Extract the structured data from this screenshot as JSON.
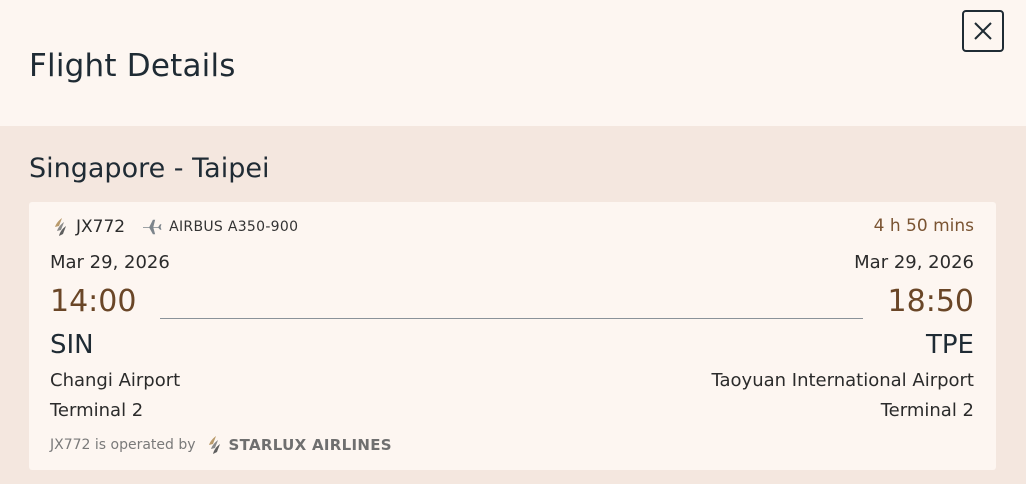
{
  "header": {
    "title": "Flight Details",
    "close_icon": "close-icon"
  },
  "route": {
    "title": "Singapore - Taipei"
  },
  "flight": {
    "brand_icon": "starlux-logo-icon",
    "number": "JX772",
    "aircraft_icon": "plane-icon",
    "aircraft": "AIRBUS A350-900",
    "duration": "4 h 50 mins",
    "departure": {
      "date": "Mar 29, 2026",
      "time": "14:00",
      "code": "SIN",
      "airport": "Changi Airport",
      "terminal": "Terminal 2"
    },
    "arrival": {
      "date": "Mar 29, 2026",
      "time": "18:50",
      "code": "TPE",
      "airport": "Taoyuan International Airport",
      "terminal": "Terminal 2"
    },
    "operated_by_text": "JX772 is operated by",
    "operator_logo_icon": "starlux-logo-icon",
    "operator_name": "STARLUX AIRLINES"
  },
  "colors": {
    "background": "#fdf6f1",
    "section_background": "#f4e7df",
    "time_accent": "#6a4627",
    "duration_accent": "#7a5432",
    "title_text": "#1f2b34"
  }
}
